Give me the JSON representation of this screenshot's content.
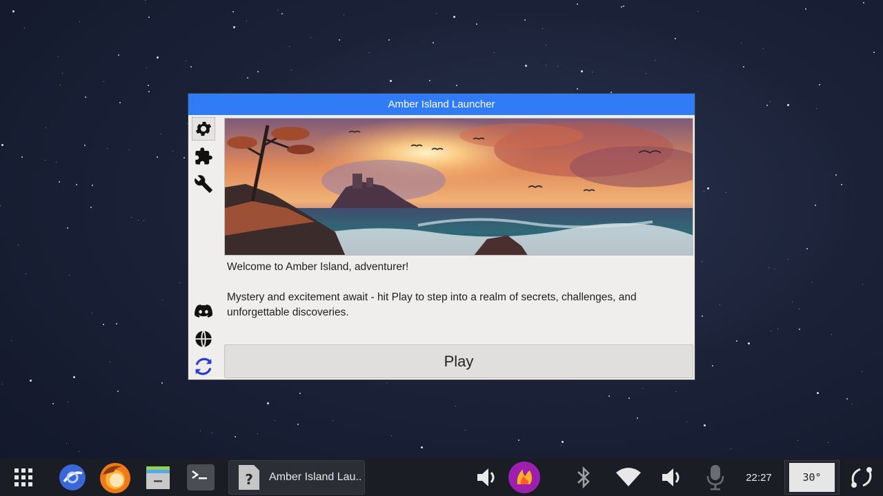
{
  "window": {
    "title": "Amber Island Launcher",
    "welcome": "Welcome to Amber Island, adventurer!",
    "description": "Mystery and excitement await - hit Play to step into a realm of secrets, challenges, and unforgettable discoveries.",
    "play_label": "Play",
    "sidebar_top": [
      {
        "icon": "gear-icon"
      },
      {
        "icon": "puzzle-icon"
      },
      {
        "icon": "wrench-icon"
      }
    ],
    "sidebar_bottom": [
      {
        "icon": "discord-icon"
      },
      {
        "icon": "globe-icon"
      },
      {
        "icon": "refresh-icon"
      }
    ],
    "banner": {
      "description_icon": "seascape-banner-image"
    }
  },
  "taskbar": {
    "apps": [
      {
        "icon": "app-grid-icon"
      },
      {
        "icon": "browser-icon"
      },
      {
        "icon": "firefox-icon"
      },
      {
        "icon": "file-manager-icon"
      },
      {
        "icon": "terminal-icon"
      }
    ],
    "active_task": {
      "icon": "unknown-app-icon",
      "label": "Amber Island Lau.."
    },
    "tray": [
      {
        "icon": "volume-icon"
      },
      {
        "icon": "flame-app-icon"
      },
      {
        "icon": "bluetooth-icon"
      },
      {
        "icon": "wifi-icon"
      },
      {
        "icon": "volume-icon"
      },
      {
        "icon": "microphone-icon"
      }
    ],
    "clock": "22:27",
    "temperature": "30°",
    "accent": "#2f7cf6"
  }
}
